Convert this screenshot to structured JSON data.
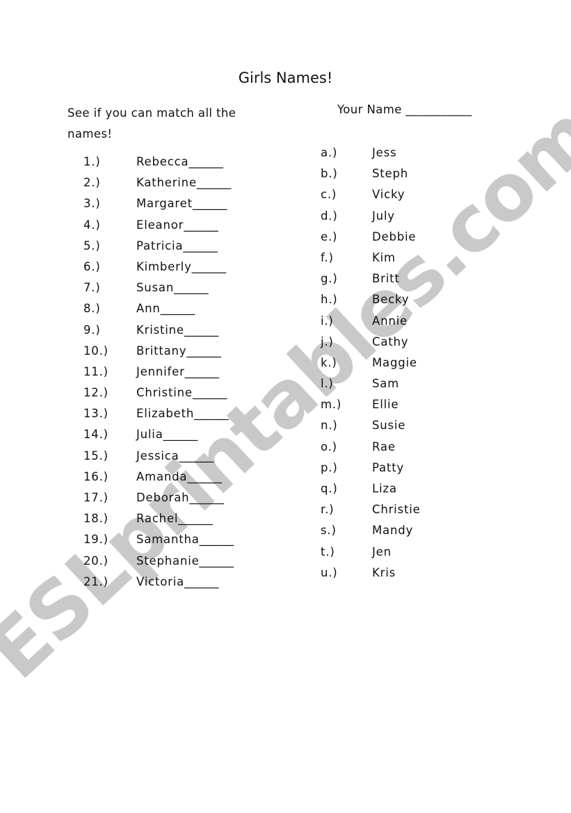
{
  "watermark": "ESLprintables.com",
  "title": "Girls Names!",
  "instructions": "See if you can match all the names!",
  "your_name_label": "Your Name ___________",
  "blank": "______",
  "full_names": [
    {
      "num": "1.)",
      "name": "Rebecca"
    },
    {
      "num": "2.)",
      "name": "Katherine"
    },
    {
      "num": "3.)",
      "name": "Margaret"
    },
    {
      "num": "4.)",
      "name": "Eleanor"
    },
    {
      "num": "5.)",
      "name": "Patricia"
    },
    {
      "num": "6.)",
      "name": "Kimberly"
    },
    {
      "num": "7.)",
      "name": "Susan"
    },
    {
      "num": "8.)",
      "name": "Ann"
    },
    {
      "num": "9.)",
      "name": "Kristine"
    },
    {
      "num": "10.)",
      "name": "Brittany"
    },
    {
      "num": "11.)",
      "name": "Jennifer"
    },
    {
      "num": "12.)",
      "name": "Christine"
    },
    {
      "num": "13.)",
      "name": "Elizabeth"
    },
    {
      "num": "14.)",
      "name": "Julia"
    },
    {
      "num": "15.)",
      "name": "Jessica"
    },
    {
      "num": "16.)",
      "name": "Amanda"
    },
    {
      "num": "17.)",
      "name": "Deborah"
    },
    {
      "num": "18.)",
      "name": "Rachel"
    },
    {
      "num": "19.)",
      "name": "Samantha"
    },
    {
      "num": "20.)",
      "name": "Stephanie"
    },
    {
      "num": "21.)",
      "name": "Victoria"
    }
  ],
  "nicknames": [
    {
      "letter": "a.)",
      "name": "Jess"
    },
    {
      "letter": "b.)",
      "name": "Steph"
    },
    {
      "letter": "c.)",
      "name": "Vicky"
    },
    {
      "letter": "d.)",
      "name": "July"
    },
    {
      "letter": "e.)",
      "name": "Debbie"
    },
    {
      "letter": "f.)",
      "name": "Kim"
    },
    {
      "letter": "g.)",
      "name": "Britt"
    },
    {
      "letter": "h.)",
      "name": "Becky"
    },
    {
      "letter": "i.)",
      "name": "Annie"
    },
    {
      "letter": "j.)",
      "name": "Cathy"
    },
    {
      "letter": "k.)",
      "name": "Maggie"
    },
    {
      "letter": "l.)",
      "name": "Sam"
    },
    {
      "letter": "m.)",
      "name": "Ellie"
    },
    {
      "letter": "n.)",
      "name": "Susie"
    },
    {
      "letter": "o.)",
      "name": "Rae"
    },
    {
      "letter": "p.)",
      "name": "Patty"
    },
    {
      "letter": "q.)",
      "name": "Liza"
    },
    {
      "letter": "r.)",
      "name": "Christie"
    },
    {
      "letter": "s.)",
      "name": "Mandy"
    },
    {
      "letter": "t.)",
      "name": "Jen"
    },
    {
      "letter": "u.)",
      "name": "Kris"
    }
  ]
}
